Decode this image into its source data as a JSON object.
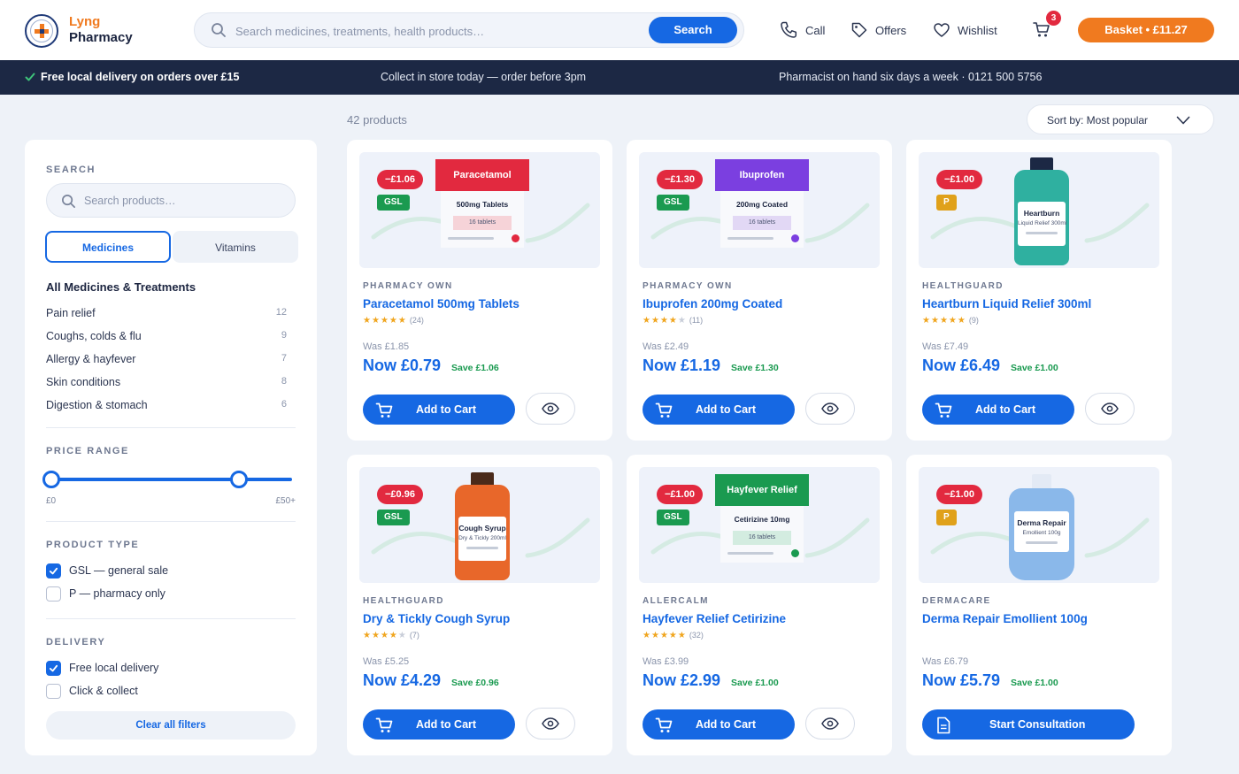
{
  "brand": {
    "name_line1": "Lyng",
    "name_line2": "Pharmacy"
  },
  "header": {
    "search_placeholder": "Search medicines, treatments, health products…",
    "search_button": "Search",
    "call_label": "Call",
    "offers_label": "Offers",
    "wishlist_label": "Wishlist",
    "cart_count": "3",
    "basket_label": "Basket • £11.27"
  },
  "infobar": {
    "delivery": "Free local delivery on orders over £15",
    "collect": "Collect in store today — order before 3pm",
    "pharmacist": "Pharmacist on hand six days a week · 0121 500 5756"
  },
  "toolbar": {
    "count": "42 products",
    "sort_label": "Sort by: Most popular"
  },
  "sidebar": {
    "search_title": "SEARCH",
    "search_placeholder": "Search products…",
    "segment_active": "Medicines",
    "segment_inactive": "Vitamins",
    "category_heading": "All Medicines & Treatments",
    "categories": [
      {
        "label": "Pain relief",
        "count": "12"
      },
      {
        "label": "Coughs, colds & flu",
        "count": "9"
      },
      {
        "label": "Allergy & hayfever",
        "count": "7"
      },
      {
        "label": "Skin conditions",
        "count": "8"
      },
      {
        "label": "Digestion & stomach",
        "count": "6"
      }
    ],
    "price_title": "PRICE RANGE",
    "price_min_label": "£0",
    "price_max_label": "£50+",
    "price_selected_min_fraction": 0.0,
    "price_selected_max_fraction": 0.78,
    "type_title": "PRODUCT TYPE",
    "type_options": [
      {
        "label": "GSL — general sale",
        "checked": true
      },
      {
        "label": "P — pharmacy only",
        "checked": false
      }
    ],
    "delivery_title": "DELIVERY",
    "delivery_options": [
      {
        "label": "Free local delivery",
        "checked": true
      },
      {
        "label": "Click & collect",
        "checked": false
      }
    ],
    "clear_label": "Clear all filters"
  },
  "products": [
    {
      "save_badge": "−£1.06",
      "type": "GSL",
      "brand": "PHARMACY OWN",
      "name": "Paracetamol 500mg Tablets",
      "rating": 5,
      "reviews": "(24)",
      "was": "Was £1.85",
      "now": "Now £0.79",
      "save": "Save £1.06",
      "action": "Add to Cart",
      "art": {
        "kind": "box",
        "title": "Paracetamol",
        "sub": "500mg Tablets",
        "chip": "16 tablets",
        "color": "#e2293f",
        "chip_color": "#f6d3d8"
      }
    },
    {
      "save_badge": "−£1.30",
      "type": "GSL",
      "brand": "PHARMACY OWN",
      "name": "Ibuprofen 200mg Coated",
      "rating": 4,
      "reviews": "(11)",
      "was": "Was £2.49",
      "now": "Now £1.19",
      "save": "Save £1.30",
      "action": "Add to Cart",
      "art": {
        "kind": "box",
        "title": "Ibuprofen",
        "sub": "200mg Coated",
        "chip": "16 tablets",
        "color": "#7b3fe0",
        "chip_color": "#e2d8f5"
      }
    },
    {
      "save_badge": "−£1.00",
      "type": "P",
      "brand": "HEALTHGUARD",
      "name": "Heartburn Liquid Relief 300ml",
      "rating": 5,
      "reviews": "(9)",
      "was": "Was £7.49",
      "now": "Now £6.49",
      "save": "Save £1.00",
      "action": "Add to Cart",
      "art": {
        "kind": "bottle",
        "title": "Heartburn",
        "sub": "Liquid Relief 300ml",
        "color": "#2fb0a0",
        "cap_color": "#1c2844"
      }
    },
    {
      "save_badge": "−£0.96",
      "type": "GSL",
      "brand": "HEALTHGUARD",
      "name": "Dry & Tickly Cough Syrup",
      "rating": 4,
      "reviews": "(7)",
      "was": "Was £5.25",
      "now": "Now £4.29",
      "save": "Save £0.96",
      "action": "Add to Cart",
      "art": {
        "kind": "bottle",
        "title": "Cough Syrup",
        "sub": "Dry & Tickly 200ml",
        "color": "#e8672a",
        "cap_color": "#4a2a1a"
      }
    },
    {
      "save_badge": "−£1.00",
      "type": "GSL",
      "brand": "ALLERCALM",
      "name": "Hayfever Relief Cetirizine",
      "rating": 5,
      "reviews": "(32)",
      "was": "Was £3.99",
      "now": "Now £2.99",
      "save": "Save £1.00",
      "action": "Add to Cart",
      "art": {
        "kind": "box",
        "title": "Hayfever Relief",
        "sub": "Cetirizine 10mg",
        "chip": "16 tablets",
        "color": "#1a9a50",
        "chip_color": "#d3ece0"
      }
    },
    {
      "save_badge": "−£1.00",
      "type": "P",
      "brand": "DERMACARE",
      "name": "Derma Repair Emollient 100g",
      "rating": 0,
      "reviews": "",
      "was": "Was £6.79",
      "now": "Now £5.79",
      "save": "Save £1.00",
      "action": "Start Consultation",
      "art": {
        "kind": "tube",
        "title": "Derma Repair",
        "sub": "Emollient 100g",
        "color": "#8ab8ea",
        "cap_color": "#e3eaf5"
      }
    }
  ]
}
